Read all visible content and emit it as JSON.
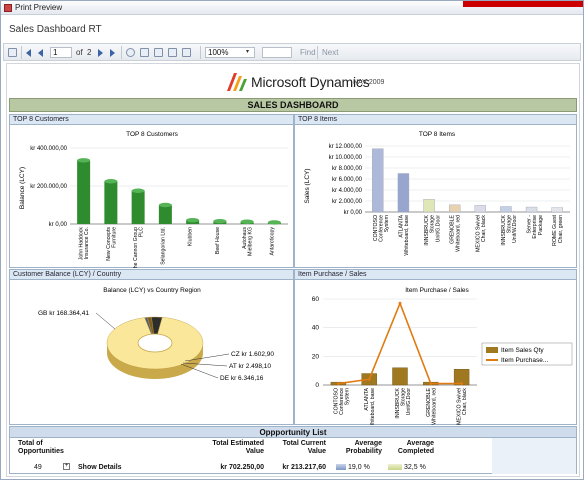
{
  "window": {
    "title": "Print Preview"
  },
  "header": {
    "title": "Sales Dashboard RT"
  },
  "toolbar": {
    "page": "1",
    "of_label": "of",
    "total_pages": "2",
    "zoom": "100%",
    "find_label": "Find",
    "next_label": "Next"
  },
  "report": {
    "logo_text": "Microsoft Dynamics",
    "logo_sub": "NAV 2009",
    "banner": "SALES DASHBOARD",
    "panels": {
      "top_customers": "TOP 8 Customers",
      "top_items": "TOP 8 Items",
      "customer_balance": "Customer Balance (LCY) / Country",
      "item_purchase": "Item Purchase / Sales"
    },
    "opportunity": {
      "title": "Oppportunity List",
      "headers": {
        "total_opps": "Total of Opportunities",
        "est_value": "Total Estimated Value",
        "cur_value": "Total Current Value",
        "avg_prob": "Average Probability",
        "avg_completed": "Average Completed"
      },
      "values": {
        "total_opps": "49",
        "show_details": "Show Details",
        "est_value": "kr 702.250,00",
        "cur_value": "kr 213.217,60",
        "avg_prob": "19,0 %",
        "avg_completed": "32,5 %"
      }
    }
  },
  "chart_data": [
    {
      "type": "bar",
      "title": "TOP 8 Customers",
      "ylabel": "Balance (LCY)",
      "categories": [
        "John Haddock Insurance Co.",
        "New Concepts Furniture",
        "The Cannon Group PLC",
        "Selangorian Ltd.",
        "Klubben",
        "Beef House",
        "Autohaus Mielberg KG",
        "Antarcticopy"
      ],
      "values": [
        335000,
        225000,
        175000,
        100000,
        20000,
        15000,
        12000,
        8000
      ],
      "ylim": [
        0,
        400000
      ],
      "yticks": [
        "kr 0,00",
        "kr 200.000,00",
        "kr 400.000,00"
      ],
      "color": "#2e8b2e"
    },
    {
      "type": "bar",
      "title": "TOP 8 Items",
      "ylabel": "Sales (LCY)",
      "categories": [
        "CONTOSO Conference System",
        "ATLANTA Whiteboard, base",
        "INNSBRUCK Storage Unit/G.Door",
        "GRENOBLE Whiteboard, red",
        "MEXICO Swivel Chair, black",
        "INNSBRUCK Storage Unit/W.Door",
        "Server - Enterprise Package",
        "ROME Guest Chair, green"
      ],
      "values": [
        11500,
        7000,
        2300,
        1300,
        1200,
        1000,
        900,
        800
      ],
      "ylim": [
        0,
        12000
      ],
      "yticks": [
        "kr 0,00",
        "kr 2.000,00",
        "kr 4.000,00",
        "kr 6.000,00",
        "kr 8.000,00",
        "kr 10.000,00",
        "kr 12.000,00"
      ]
    },
    {
      "type": "pie",
      "title": "Balance (LCY) vs Country Region",
      "labels": [
        "GB",
        "CZ",
        "AT",
        "DE"
      ],
      "values": [
        168364.41,
        1602.9,
        2498.1,
        6346.16
      ],
      "display": [
        "GB kr 168.364,41",
        "CZ kr 1.602,90",
        "AT kr 2.498,10",
        "DE kr 6.346,16"
      ]
    },
    {
      "type": "bar",
      "title": "Item Purchase / Sales",
      "categories": [
        "CONTOSO Conference System",
        "ATLANTA Whiteboard, base",
        "INNSBRUCK Storage Unit/G.Door",
        "GRENOBLE Whiteboard, red",
        "MEXICO Swivel Chair, black"
      ],
      "ylim": [
        0,
        60
      ],
      "yticks": [
        "0",
        "20",
        "40",
        "60"
      ],
      "series": [
        {
          "name": "Item Sales Qty",
          "values": [
            2,
            8,
            12,
            2,
            11
          ],
          "color": "#a07820"
        },
        {
          "name": "Item  Purchase...",
          "values": [
            1,
            4,
            57,
            1,
            1
          ],
          "color": "#e07b12"
        }
      ]
    }
  ]
}
